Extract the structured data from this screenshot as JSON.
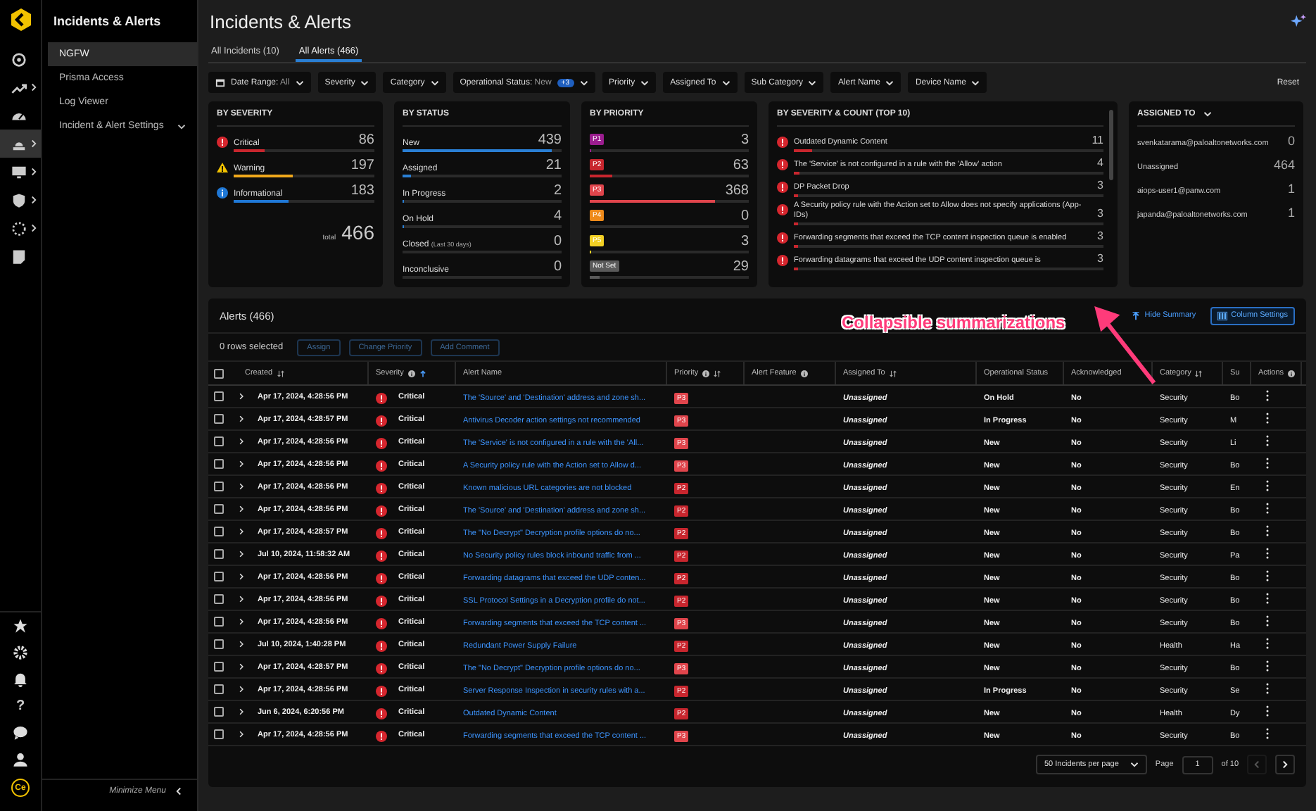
{
  "rail": {
    "items": [
      {
        "kind": "radar",
        "has_submenu": false,
        "selected": false
      },
      {
        "kind": "activity",
        "has_submenu": true,
        "selected": false
      },
      {
        "kind": "gauge",
        "has_submenu": false,
        "selected": false
      },
      {
        "kind": "siren",
        "has_submenu": true,
        "selected": true
      },
      {
        "kind": "monitor",
        "has_submenu": true,
        "selected": false
      },
      {
        "kind": "shield",
        "has_submenu": true,
        "selected": false
      },
      {
        "kind": "dashed-gear",
        "has_submenu": true,
        "selected": false
      },
      {
        "kind": "report",
        "has_submenu": false,
        "selected": false
      }
    ],
    "bottom": [
      {
        "kind": "star"
      },
      {
        "kind": "gear"
      },
      {
        "kind": "bell"
      },
      {
        "kind": "help",
        "text": "?"
      },
      {
        "kind": "chat"
      },
      {
        "kind": "user"
      },
      {
        "kind": "avatar",
        "text": "Ce"
      }
    ]
  },
  "nav": {
    "title": "Incidents & Alerts",
    "items": [
      {
        "label": "NGFW",
        "selected": true
      },
      {
        "label": "Prisma Access",
        "selected": false
      },
      {
        "label": "Log Viewer",
        "selected": false
      },
      {
        "label": "Incident & Alert Settings",
        "selected": false,
        "expanded": false
      }
    ],
    "minimize_label": "Minimize Menu"
  },
  "page": {
    "title": "Incidents & Alerts"
  },
  "tabs": [
    {
      "label": "All Incidents (10)",
      "selected": false
    },
    {
      "label": "All Alerts (466)",
      "selected": true
    }
  ],
  "filters": [
    {
      "kind": "date",
      "label": "Date Range:",
      "value": "All"
    },
    {
      "kind": "select",
      "label": "Severity"
    },
    {
      "kind": "select",
      "label": "Category"
    },
    {
      "kind": "select",
      "label": "Operational Status:",
      "value": "New",
      "badge": "+3"
    },
    {
      "kind": "select",
      "label": "Priority"
    },
    {
      "kind": "select",
      "label": "Assigned To"
    },
    {
      "kind": "select",
      "label": "Sub Category"
    },
    {
      "kind": "select",
      "label": "Alert Name"
    },
    {
      "kind": "select",
      "label": "Device Name"
    }
  ],
  "reset_label": "Reset",
  "summary": {
    "by_severity": {
      "title": "BY SEVERITY",
      "items": [
        {
          "kind": "critical",
          "label": "Critical",
          "count": "86",
          "level": 0.22,
          "color": "#c8262e"
        },
        {
          "kind": "warning",
          "label": "Warning",
          "count": "197",
          "level": 0.42,
          "color": "#f0a81c"
        },
        {
          "kind": "info",
          "label": "Informational",
          "count": "183",
          "level": 0.39,
          "color": "#1f78d6"
        }
      ],
      "total_label": "total",
      "total": "466"
    },
    "by_status": {
      "title": "BY STATUS",
      "items": [
        {
          "label": "New",
          "count": "439",
          "level": 0.94
        },
        {
          "label": "Assigned",
          "count": "21",
          "level": 0.05
        },
        {
          "label": "In Progress",
          "count": "2",
          "level": 0.01
        },
        {
          "label": "On Hold",
          "count": "4",
          "level": 0.01
        },
        {
          "label": "Closed",
          "note": "(Last 30 days)",
          "count": "0",
          "level": 0
        },
        {
          "label": "Inconclusive",
          "count": "0",
          "level": 0
        }
      ]
    },
    "by_priority": {
      "title": "BY PRIORITY",
      "items": [
        {
          "label": "P1",
          "count": "3",
          "level": 0.01,
          "color": "#9b1d8f"
        },
        {
          "label": "P2",
          "count": "63",
          "level": 0.14,
          "color": "#c8262e"
        },
        {
          "label": "P3",
          "count": "368",
          "level": 0.79,
          "color": "#e0454c"
        },
        {
          "label": "P4",
          "count": "0",
          "level": 0,
          "color": "#ee8a1a"
        },
        {
          "label": "P5",
          "count": "3",
          "level": 0.01,
          "color": "#f2d024"
        },
        {
          "label": "Not Set",
          "count": "29",
          "level": 0.06,
          "color": "#5a5a5a"
        }
      ]
    },
    "top10": {
      "title": "BY SEVERITY & COUNT (TOP 10)",
      "items": [
        {
          "label": "Outdated Dynamic Content",
          "count": "11",
          "level": 0.06
        },
        {
          "label": "The 'Service' is not configured in a rule with the 'Allow' action",
          "count": "4",
          "level": 0.02
        },
        {
          "label": "DP Packet Drop",
          "count": "3",
          "level": 0.015
        },
        {
          "label": "A Security policy rule with the Action set to Allow does not specify applications (App-IDs)",
          "count": "3",
          "level": 0.015
        },
        {
          "label": "Forwarding segments that exceed the TCP content inspection queue is enabled",
          "count": "3",
          "level": 0.015
        },
        {
          "label": "Forwarding datagrams that exceed the UDP content inspection queue is",
          "count": "3",
          "level": 0.015
        }
      ]
    },
    "assigned_to": {
      "title": "ASSIGNED TO",
      "items": [
        {
          "label": "svenkatarama@paloaltonetworks.com",
          "count": "0"
        },
        {
          "label": "Unassigned",
          "count": "464"
        },
        {
          "label": "aiops-user1@panw.com",
          "count": "1"
        },
        {
          "label": "japanda@paloaltonetworks.com",
          "count": "1"
        }
      ]
    }
  },
  "alerts": {
    "title": "Alerts (466)",
    "hide_summary": "Hide Summary",
    "column_settings": "Column Settings",
    "selected_count": "0 rows selected",
    "bulk_actions": [
      {
        "label": "Assign",
        "disabled": true
      },
      {
        "label": "Change Priority",
        "disabled": true
      },
      {
        "label": "Add Comment",
        "disabled": true
      }
    ],
    "select_all_checked": false,
    "columns": [
      {
        "label": "Created",
        "sortable": true,
        "sorted": false,
        "info": false
      },
      {
        "label": "Severity",
        "sortable": true,
        "sorted": true,
        "info": true
      },
      {
        "label": "Alert Name",
        "sortable": false,
        "sorted": false,
        "info": false
      },
      {
        "label": "Priority",
        "sortable": true,
        "sorted": false,
        "info": true
      },
      {
        "label": "Alert Feature",
        "sortable": false,
        "sorted": false,
        "info": true
      },
      {
        "label": "Assigned To",
        "sortable": true,
        "sorted": false,
        "info": false
      },
      {
        "label": "Operational Status",
        "sortable": false,
        "sorted": false,
        "info": false
      },
      {
        "label": "Acknowledged",
        "sortable": false,
        "sorted": false,
        "info": false
      },
      {
        "label": "Category",
        "sortable": true,
        "sorted": false,
        "info": false
      },
      {
        "label": "Su",
        "sortable": false,
        "sorted": false,
        "info": false
      },
      {
        "label": "Actions",
        "sortable": false,
        "sorted": false,
        "info": true
      }
    ],
    "rows": [
      {
        "checked": false,
        "created": "Apr 17, 2024, 4:28:56 PM",
        "severity": "Critical",
        "alert_name": "The 'Source' and 'Destination' address and zone sh...",
        "priority": {
          "label": "P3",
          "color": "#e0454c"
        },
        "assigned_to": "Unassigned",
        "status": "On Hold",
        "acknowledged": "No",
        "category": "Security",
        "column_10": "Bo"
      },
      {
        "checked": false,
        "created": "Apr 17, 2024, 4:28:57 PM",
        "severity": "Critical",
        "alert_name": "Antivirus Decoder action settings not recommended",
        "priority": {
          "label": "P3",
          "color": "#e0454c"
        },
        "assigned_to": "Unassigned",
        "status": "In Progress",
        "acknowledged": "No",
        "category": "Security",
        "column_10": "M"
      },
      {
        "checked": false,
        "created": "Apr 17, 2024, 4:28:56 PM",
        "severity": "Critical",
        "alert_name": "The 'Service' is not configured in a rule with the 'All...",
        "priority": {
          "label": "P3",
          "color": "#e0454c"
        },
        "assigned_to": "Unassigned",
        "status": "New",
        "acknowledged": "No",
        "category": "Security",
        "column_10": "Li"
      },
      {
        "checked": false,
        "created": "Apr 17, 2024, 4:28:56 PM",
        "severity": "Critical",
        "alert_name": "A Security policy rule with the Action set to Allow d...",
        "priority": {
          "label": "P3",
          "color": "#e0454c"
        },
        "assigned_to": "Unassigned",
        "status": "New",
        "acknowledged": "No",
        "category": "Security",
        "column_10": "Bo"
      },
      {
        "checked": false,
        "created": "Apr 17, 2024, 4:28:56 PM",
        "severity": "Critical",
        "alert_name": "Known malicious URL categories are not blocked",
        "priority": {
          "label": "P2",
          "color": "#c8262e"
        },
        "assigned_to": "Unassigned",
        "status": "New",
        "acknowledged": "No",
        "category": "Security",
        "column_10": "En"
      },
      {
        "checked": false,
        "created": "Apr 17, 2024, 4:28:56 PM",
        "severity": "Critical",
        "alert_name": "The 'Source' and 'Destination' address and zone sh...",
        "priority": {
          "label": "P2",
          "color": "#c8262e"
        },
        "assigned_to": "Unassigned",
        "status": "New",
        "acknowledged": "No",
        "category": "Security",
        "column_10": "Bo"
      },
      {
        "checked": false,
        "created": "Apr 17, 2024, 4:28:57 PM",
        "severity": "Critical",
        "alert_name": "The \"No Decrypt\" Decryption profile options do no...",
        "priority": {
          "label": "P2",
          "color": "#c8262e"
        },
        "assigned_to": "Unassigned",
        "status": "New",
        "acknowledged": "No",
        "category": "Security",
        "column_10": "Bo"
      },
      {
        "checked": false,
        "created": "Jul 10, 2024, 11:58:32 AM",
        "severity": "Critical",
        "alert_name": "No Security policy rules block inbound traffic from ...",
        "priority": {
          "label": "P2",
          "color": "#c8262e"
        },
        "assigned_to": "Unassigned",
        "status": "New",
        "acknowledged": "No",
        "category": "Security",
        "column_10": "Pa"
      },
      {
        "checked": false,
        "created": "Apr 17, 2024, 4:28:56 PM",
        "severity": "Critical",
        "alert_name": "Forwarding datagrams that exceed the UDP conten...",
        "priority": {
          "label": "P2",
          "color": "#c8262e"
        },
        "assigned_to": "Unassigned",
        "status": "New",
        "acknowledged": "No",
        "category": "Security",
        "column_10": "Bo"
      },
      {
        "checked": false,
        "created": "Apr 17, 2024, 4:28:56 PM",
        "severity": "Critical",
        "alert_name": "SSL Protocol Settings in a Decryption profile do not...",
        "priority": {
          "label": "P2",
          "color": "#c8262e"
        },
        "assigned_to": "Unassigned",
        "status": "New",
        "acknowledged": "No",
        "category": "Security",
        "column_10": "Bo"
      },
      {
        "checked": false,
        "created": "Apr 17, 2024, 4:28:56 PM",
        "severity": "Critical",
        "alert_name": "Forwarding segments that exceed the TCP content ...",
        "priority": {
          "label": "P3",
          "color": "#e0454c"
        },
        "assigned_to": "Unassigned",
        "status": "New",
        "acknowledged": "No",
        "category": "Security",
        "column_10": "Bo"
      },
      {
        "checked": false,
        "created": "Jul 10, 2024, 1:40:28 PM",
        "severity": "Critical",
        "alert_name": "Redundant Power Supply Failure",
        "priority": {
          "label": "P2",
          "color": "#c8262e"
        },
        "assigned_to": "Unassigned",
        "status": "New",
        "acknowledged": "No",
        "category": "Health",
        "column_10": "Ha"
      },
      {
        "checked": false,
        "created": "Apr 17, 2024, 4:28:57 PM",
        "severity": "Critical",
        "alert_name": "The \"No Decrypt\" Decryption profile options do no...",
        "priority": {
          "label": "P3",
          "color": "#e0454c"
        },
        "assigned_to": "Unassigned",
        "status": "New",
        "acknowledged": "No",
        "category": "Security",
        "column_10": "Bo"
      },
      {
        "checked": false,
        "created": "Apr 17, 2024, 4:28:56 PM",
        "severity": "Critical",
        "alert_name": "Server Response Inspection in security rules with a...",
        "priority": {
          "label": "P2",
          "color": "#c8262e"
        },
        "assigned_to": "Unassigned",
        "status": "In Progress",
        "acknowledged": "No",
        "category": "Security",
        "column_10": "Se"
      },
      {
        "checked": false,
        "created": "Jun 6, 2024, 6:20:56 PM",
        "severity": "Critical",
        "alert_name": "Outdated Dynamic Content",
        "priority": {
          "label": "P2",
          "color": "#c8262e"
        },
        "assigned_to": "Unassigned",
        "status": "New",
        "acknowledged": "No",
        "category": "Health",
        "column_10": "Dy"
      },
      {
        "checked": false,
        "created": "Apr 17, 2024, 4:28:56 PM",
        "severity": "Critical",
        "alert_name": "Forwarding segments that exceed the TCP content ...",
        "priority": {
          "label": "P3",
          "color": "#e0454c"
        },
        "assigned_to": "Unassigned",
        "status": "New",
        "acknowledged": "No",
        "category": "Security",
        "column_10": "Bo"
      }
    ],
    "pagination": {
      "per_page": "50 Incidents per page",
      "page_label": "Page",
      "page": "1",
      "of_label": "of 10",
      "prev_disabled": true,
      "next_disabled": false
    }
  },
  "annotation": {
    "text": "Collapsible summarizations"
  }
}
